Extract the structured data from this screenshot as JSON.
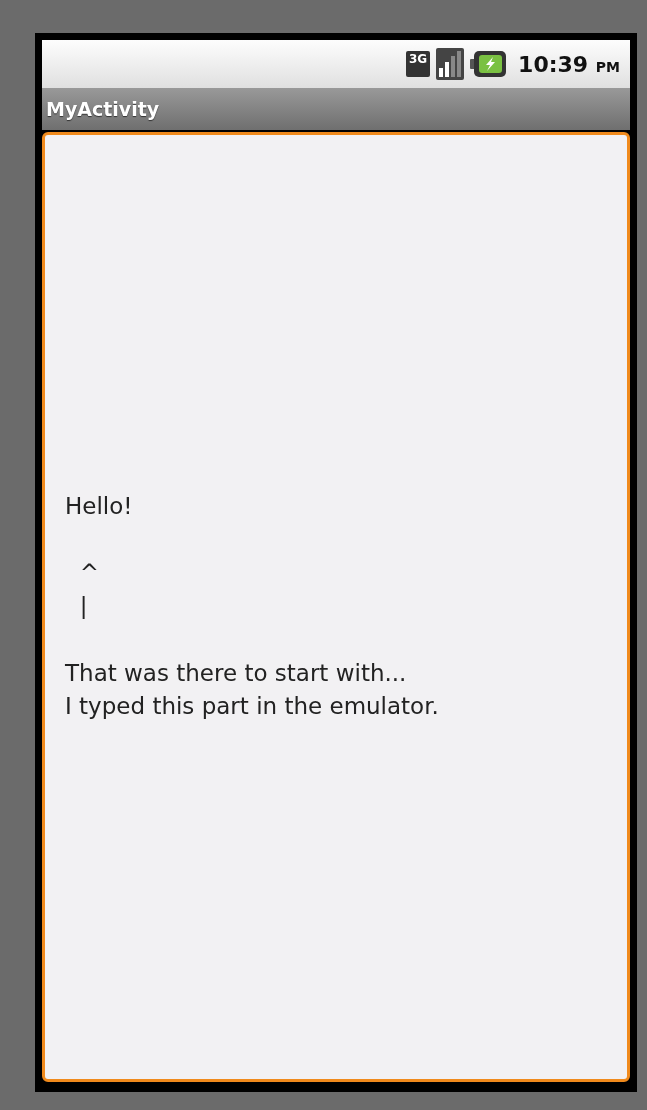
{
  "status_bar": {
    "network_type": "3G",
    "time": "10:39",
    "ampm": "PM"
  },
  "title_bar": {
    "title": "MyActivity"
  },
  "text_field": {
    "value": "Hello!\n\n  ^\n  |\n\nThat was there to start with...\nI typed this part in the emulator.",
    "focused": true
  }
}
